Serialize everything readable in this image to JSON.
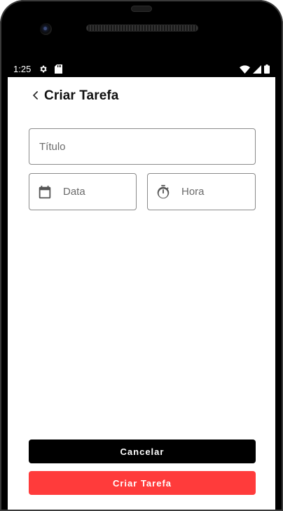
{
  "status_bar": {
    "time": "1:25",
    "icons": [
      "gear-icon",
      "sd-card-icon",
      "wifi-icon",
      "signal-icon",
      "battery-icon"
    ]
  },
  "app_bar": {
    "back_icon": "chevron-left-icon",
    "title": "Criar Tarefa"
  },
  "form": {
    "title_placeholder": "Título",
    "date_placeholder": "Data",
    "date_icon": "calendar-icon",
    "time_placeholder": "Hora",
    "time_icon": "timer-icon"
  },
  "actions": {
    "cancel_label": "Cancelar",
    "create_label": "Criar Tarefa"
  },
  "colors": {
    "primary": "#ff3b3b",
    "cancel_bg": "#000000",
    "field_border": "#8a8a8a"
  }
}
